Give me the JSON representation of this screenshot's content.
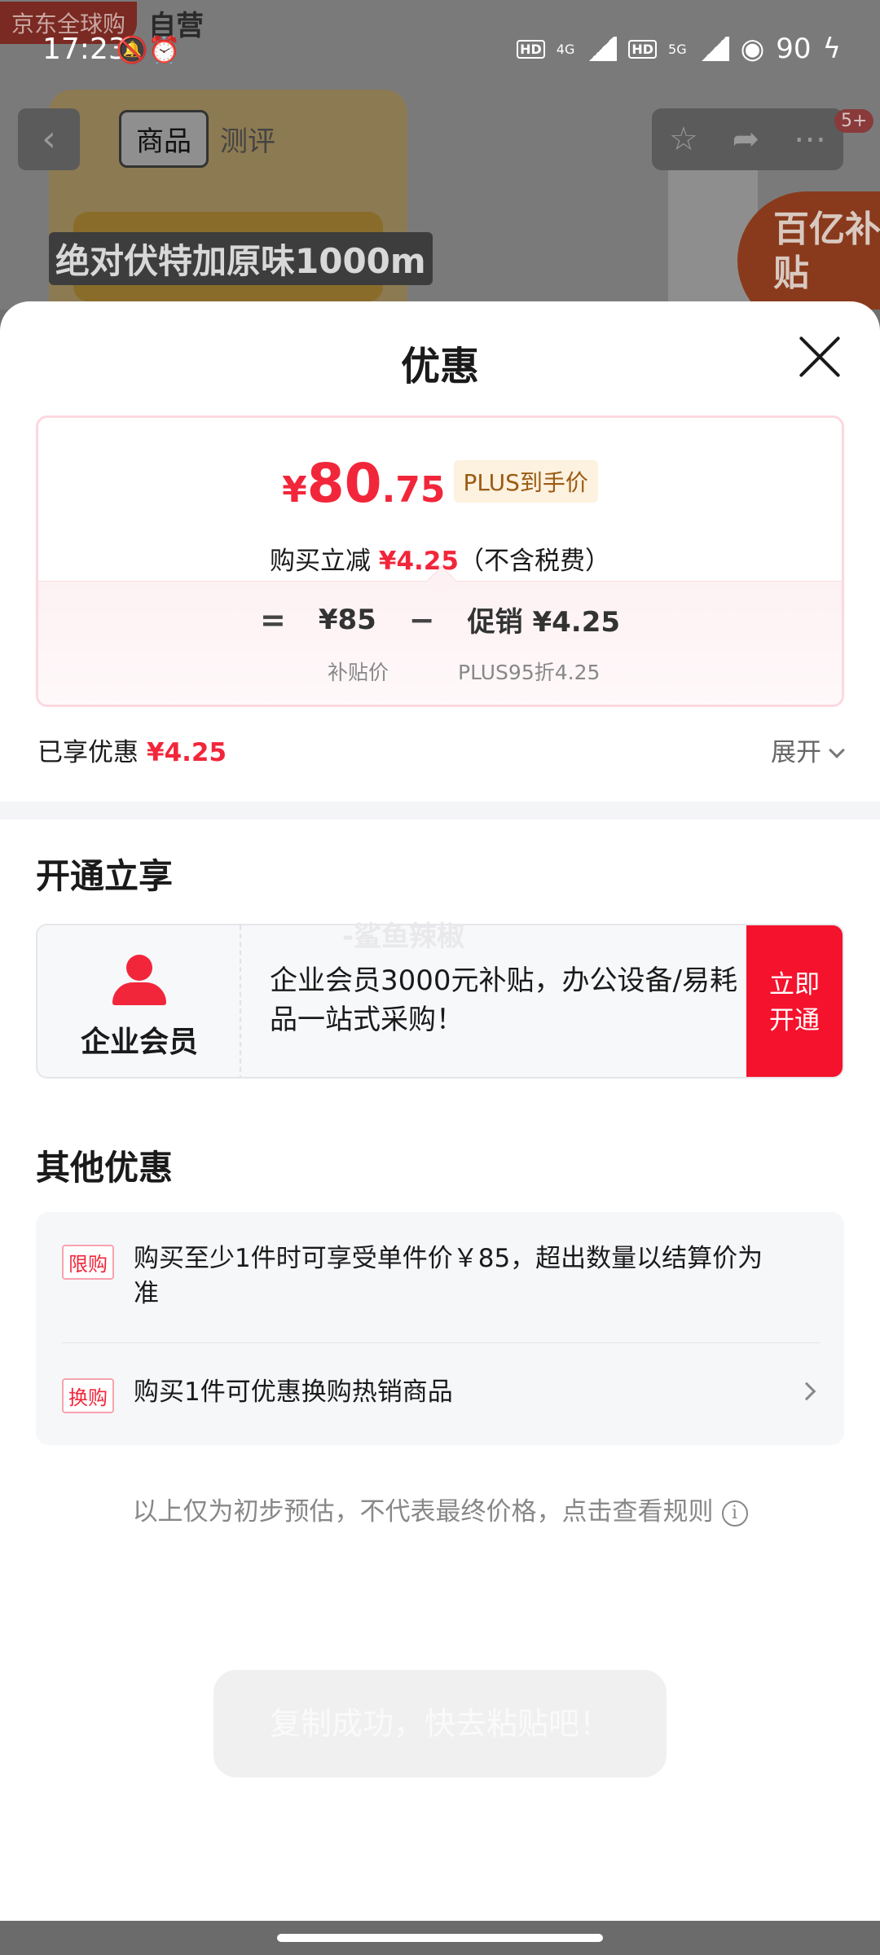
{
  "status_bar": {
    "time": "17:23",
    "net1": "4G",
    "net2": "5G",
    "battery": "90"
  },
  "background_page": {
    "store_tag": "京东全球购",
    "store_self": "自营",
    "headline": "绝对伏特加原味1000m",
    "nav_tabs": [
      "商品",
      "测评"
    ],
    "badge": "百亿补贴",
    "msg_count": "5+"
  },
  "sheet": {
    "title": "优惠",
    "price": {
      "symbol": "¥",
      "integer": "80",
      "decimal": ".75",
      "tag": "PLUS到手价",
      "sub_prefix": "购买立减",
      "sub_amount": "¥4.25",
      "sub_suffix": "（不含税费）"
    },
    "formula": {
      "eq": "=",
      "base": "¥85",
      "minus": "−",
      "promo": "促销 ¥4.25",
      "base_label": "补贴价",
      "promo_label": "PLUS95折4.25"
    },
    "enjoyed": {
      "label": "已享优惠",
      "amount": "¥4.25",
      "expand": "展开"
    },
    "open_section": {
      "title": "开通立享",
      "member_name": "企业会员",
      "member_desc": "企业会员3000元补贴，办公设备/易耗品一站式采购！",
      "button": "立即开通",
      "watermark": "-鲨鱼辣椒"
    },
    "other_section": {
      "title": "其他优惠",
      "offers": [
        {
          "tag": "限购",
          "text": "购买至少1件时可享受单件价￥85，超出数量以结算价为准"
        },
        {
          "tag": "换购",
          "text": "购买1件可优惠换购热销商品"
        }
      ]
    },
    "disclaimer": "以上仅为初步预估，不代表最终价格，点击查看规则",
    "toast": "复制成功，快去粘贴吧！"
  }
}
